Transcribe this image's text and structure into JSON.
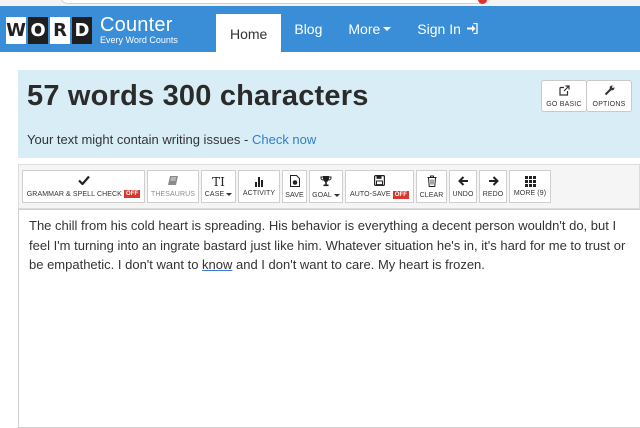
{
  "logo": {
    "letters": [
      "W",
      "O",
      "R",
      "D"
    ],
    "title": "Counter",
    "tagline": "Every Word Counts"
  },
  "nav": {
    "home": "Home",
    "blog": "Blog",
    "more": "More",
    "signin": "Sign In",
    "signin_icon": "sign-in-icon"
  },
  "header": {
    "headline": "57 words 300 characters",
    "issue_text": "Your text might contain writing issues - ",
    "issue_link": "Check now",
    "buttons": {
      "go_basic": "GO BASIC",
      "options": "OPTIONS"
    }
  },
  "toolbar": {
    "grammar": "GRAMMAR & SPELL CHECK",
    "grammar_badge": "OFF",
    "thesaurus": "THESAURUS",
    "case_icon": "TI",
    "case": "CASE",
    "activity": "ACTIVITY",
    "save": "SAVE",
    "goal": "GOAL",
    "autosave": "AUTO-SAVE",
    "autosave_badge": "OFF",
    "clear": "CLEAR",
    "undo": "UNDO",
    "redo": "REDO",
    "more": "MORE (9)"
  },
  "editor": {
    "before_misspelling": "The chill from his cold heart is spreading. His behavior is everything a decent person wouldn't do, but I feel I'm turning into an ingrate bastard just like him. Whatever situation he's in, it's hard for me to trust or be empathetic. I don't want to ",
    "misspelled_word": "know",
    "after_misspelling": " and I don't want to care. My heart is frozen."
  },
  "colors": {
    "navbar": "#3a8ed8",
    "panel": "#d9edf7",
    "link": "#2f7fc9",
    "badge": "#d9382f"
  }
}
